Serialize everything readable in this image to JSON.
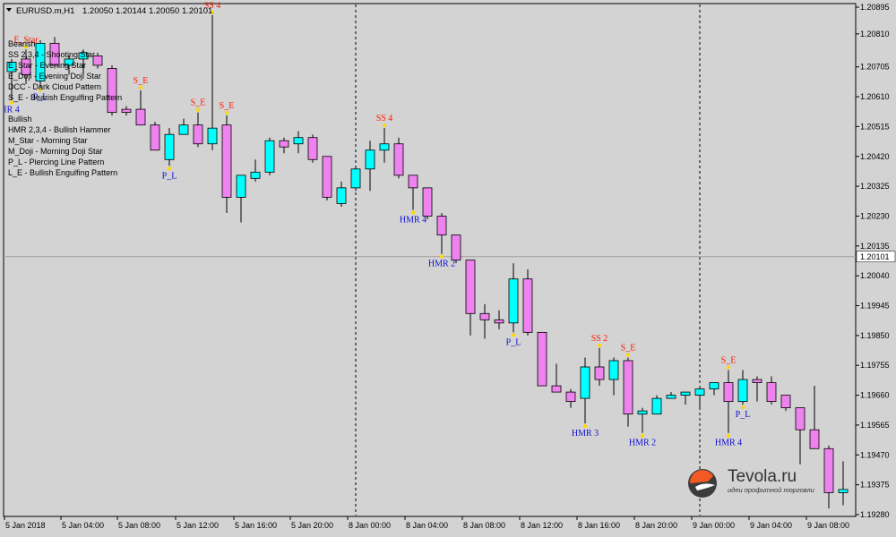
{
  "window": {
    "symbol_info": "EURUSD.m,H1",
    "ohlc_info": "1.20050 1.20144 1.20050 1.20101",
    "menu_glyph": "triangle-down-icon"
  },
  "legend": {
    "lines": [
      {
        "text": "Bearish"
      },
      {
        "text": "SS 2,3,4 - Shooting Star"
      },
      {
        "text": "E_Star   - Evening Star"
      },
      {
        "text": "E_Doji   - Evening Doji Star"
      },
      {
        "text": "DCC      - Dark Cloud Pattern"
      },
      {
        "text": "S_E      - Bearish Engulfing Pattern"
      },
      {
        "text": ""
      },
      {
        "text": "Bullish"
      },
      {
        "text": "HMR 2,3,4 - Bullish Hammer"
      },
      {
        "text": "M_Star    - Morning Star"
      },
      {
        "text": "M_Doji    - Morning Doji Star"
      },
      {
        "text": "P_L       - Piercing Line Pattern"
      },
      {
        "text": "L_E       - Bullish Engulfing Pattern"
      }
    ]
  },
  "watermark": {
    "name": "Tevola.ru",
    "tagline": "идеи профитной торговли"
  },
  "colors": {
    "bull": "#00ffff",
    "bear": "#ee82ee",
    "background": "#d3d3d3",
    "bid_line": "#a0a0a0",
    "pattern_bear": "#ff1a00",
    "pattern_bull": "#1010d0",
    "marker": "#ffd700"
  },
  "chart_data": {
    "type": "candlestick",
    "timeframe": "H1",
    "y_ticks": [
      "1.20895",
      "1.20810",
      "1.20705",
      "1.20610",
      "1.20515",
      "1.20420",
      "1.20325",
      "1.20230",
      "1.20135",
      "1.20040",
      "1.19945",
      "1.19850",
      "1.19755",
      "1.19660",
      "1.19565",
      "1.19470",
      "1.19375",
      "1.19280"
    ],
    "current_price": "1.20101",
    "x_ticks": [
      "5 Jan 2018",
      "5 Jan 04:00",
      "5 Jan 08:00",
      "5 Jan 12:00",
      "5 Jan 16:00",
      "5 Jan 20:00",
      "8 Jan 00:00",
      "8 Jan 04:00",
      "8 Jan 08:00",
      "8 Jan 12:00",
      "8 Jan 16:00",
      "8 Jan 20:00",
      "9 Jan 00:00",
      "9 Jan 04:00",
      "9 Jan 08:00"
    ],
    "day_separators": [
      "8 Jan 00:00",
      "9 Jan 00:00"
    ],
    "candles": [
      {
        "o": 1.2069,
        "h": 1.2073,
        "l": 1.206,
        "c": 1.2072
      },
      {
        "o": 1.2073,
        "h": 1.2076,
        "l": 1.2065,
        "c": 1.2068
      },
      {
        "o": 1.2066,
        "h": 1.2079,
        "l": 1.2064,
        "c": 1.2078
      },
      {
        "o": 1.2078,
        "h": 1.208,
        "l": 1.207,
        "c": 1.2071
      },
      {
        "o": 1.2071,
        "h": 1.2074,
        "l": 1.2068,
        "c": 1.2073
      },
      {
        "o": 1.2073,
        "h": 1.2076,
        "l": 1.2068,
        "c": 1.2075
      },
      {
        "o": 1.2074,
        "h": 1.2075,
        "l": 1.207,
        "c": 1.2071
      },
      {
        "o": 1.207,
        "h": 1.2071,
        "l": 1.2055,
        "c": 1.2056
      },
      {
        "o": 1.2057,
        "h": 1.2058,
        "l": 1.2055,
        "c": 1.2056
      },
      {
        "o": 1.2057,
        "h": 1.2063,
        "l": 1.2052,
        "c": 1.2052
      },
      {
        "o": 1.2052,
        "h": 1.2053,
        "l": 1.2044,
        "c": 1.2044
      },
      {
        "o": 1.2041,
        "h": 1.2051,
        "l": 1.2039,
        "c": 1.2049
      },
      {
        "o": 1.2049,
        "h": 1.2054,
        "l": 1.2049,
        "c": 1.2052
      },
      {
        "o": 1.2052,
        "h": 1.2056,
        "l": 1.2045,
        "c": 1.2046
      },
      {
        "o": 1.2046,
        "h": 1.2087,
        "l": 1.2044,
        "c": 1.2051
      },
      {
        "o": 1.2052,
        "h": 1.2055,
        "l": 1.2024,
        "c": 1.2029
      },
      {
        "o": 1.2029,
        "h": 1.2035,
        "l": 1.2021,
        "c": 1.2036
      },
      {
        "o": 1.2035,
        "h": 1.2041,
        "l": 1.2034,
        "c": 1.2037
      },
      {
        "o": 1.2037,
        "h": 1.2048,
        "l": 1.2036,
        "c": 1.2047
      },
      {
        "o": 1.2047,
        "h": 1.2048,
        "l": 1.2043,
        "c": 1.2045
      },
      {
        "o": 1.2046,
        "h": 1.205,
        "l": 1.2043,
        "c": 1.2048
      },
      {
        "o": 1.2048,
        "h": 1.2049,
        "l": 1.204,
        "c": 1.2041
      },
      {
        "o": 1.2042,
        "h": 1.2042,
        "l": 1.2028,
        "c": 1.2029
      },
      {
        "o": 1.2027,
        "h": 1.2034,
        "l": 1.2026,
        "c": 1.2032
      },
      {
        "o": 1.2032,
        "h": 1.2039,
        "l": 1.2031,
        "c": 1.2038
      },
      {
        "o": 1.2038,
        "h": 1.2047,
        "l": 1.2031,
        "c": 1.2044
      },
      {
        "o": 1.2044,
        "h": 1.2051,
        "l": 1.204,
        "c": 1.2046
      },
      {
        "o": 1.2046,
        "h": 1.2048,
        "l": 1.2035,
        "c": 1.2036
      },
      {
        "o": 1.2036,
        "h": 1.2036,
        "l": 1.2025,
        "c": 1.2032
      },
      {
        "o": 1.2032,
        "h": 1.2032,
        "l": 1.2022,
        "c": 1.2023
      },
      {
        "o": 1.2023,
        "h": 1.2024,
        "l": 1.2011,
        "c": 1.2017
      },
      {
        "o": 1.2017,
        "h": 1.2017,
        "l": 1.2008,
        "c": 1.2009
      },
      {
        "o": 1.2009,
        "h": 1.2009,
        "l": 1.1985,
        "c": 1.1992
      },
      {
        "o": 1.1992,
        "h": 1.1995,
        "l": 1.1984,
        "c": 1.199
      },
      {
        "o": 1.199,
        "h": 1.1993,
        "l": 1.1987,
        "c": 1.1989
      },
      {
        "o": 1.1989,
        "h": 1.2008,
        "l": 1.1986,
        "c": 1.2003
      },
      {
        "o": 1.2003,
        "h": 1.2006,
        "l": 1.1985,
        "c": 1.1986
      },
      {
        "o": 1.1986,
        "h": 1.1986,
        "l": 1.1969,
        "c": 1.1969
      },
      {
        "o": 1.1969,
        "h": 1.1976,
        "l": 1.1967,
        "c": 1.1967
      },
      {
        "o": 1.1967,
        "h": 1.1968,
        "l": 1.1962,
        "c": 1.1964
      },
      {
        "o": 1.1965,
        "h": 1.1978,
        "l": 1.1957,
        "c": 1.1975
      },
      {
        "o": 1.1975,
        "h": 1.1981,
        "l": 1.1969,
        "c": 1.1971
      },
      {
        "o": 1.1971,
        "h": 1.1978,
        "l": 1.1966,
        "c": 1.1977
      },
      {
        "o": 1.1977,
        "h": 1.1978,
        "l": 1.1956,
        "c": 1.196
      },
      {
        "o": 1.196,
        "h": 1.1962,
        "l": 1.1954,
        "c": 1.1961
      },
      {
        "o": 1.196,
        "h": 1.1966,
        "l": 1.196,
        "c": 1.1965
      },
      {
        "o": 1.1965,
        "h": 1.1967,
        "l": 1.1965,
        "c": 1.1966
      },
      {
        "o": 1.1966,
        "h": 1.1967,
        "l": 1.1963,
        "c": 1.1967
      },
      {
        "o": 1.1966,
        "h": 1.1968,
        "l": 1.1962,
        "c": 1.1968
      },
      {
        "o": 1.1968,
        "h": 1.197,
        "l": 1.1966,
        "c": 1.197
      },
      {
        "o": 1.197,
        "h": 1.1974,
        "l": 1.1954,
        "c": 1.1964
      },
      {
        "o": 1.1964,
        "h": 1.1974,
        "l": 1.1963,
        "c": 1.1971
      },
      {
        "o": 1.1971,
        "h": 1.1972,
        "l": 1.1964,
        "c": 1.197
      },
      {
        "o": 1.197,
        "h": 1.1972,
        "l": 1.1963,
        "c": 1.1964
      },
      {
        "o": 1.1966,
        "h": 1.1966,
        "l": 1.1961,
        "c": 1.1962
      },
      {
        "o": 1.1962,
        "h": 1.1962,
        "l": 1.1944,
        "c": 1.1955
      },
      {
        "o": 1.1955,
        "h": 1.1969,
        "l": 1.1949,
        "c": 1.1949
      },
      {
        "o": 1.1949,
        "h": 1.195,
        "l": 1.193,
        "c": 1.1935
      },
      {
        "o": 1.1935,
        "h": 1.1945,
        "l": 1.1931,
        "c": 1.1936
      }
    ],
    "patterns": [
      {
        "label": "S_E",
        "type": "bear",
        "candle": 9
      },
      {
        "label": "SS 4",
        "type": "bear",
        "candle": 14
      },
      {
        "label": "S_E",
        "type": "bear",
        "candle": 13
      },
      {
        "label": "S_E",
        "type": "bear",
        "candle": 15
      },
      {
        "label": "P_L",
        "type": "bull",
        "candle": 11
      },
      {
        "label": "SS 4",
        "type": "bear",
        "candle": 26
      },
      {
        "label": "HMR 4",
        "type": "bull",
        "candle": 28
      },
      {
        "label": "HMR 2",
        "type": "bull",
        "candle": 30
      },
      {
        "label": "P_L",
        "type": "bull",
        "candle": 35
      },
      {
        "label": "SS 2",
        "type": "bear",
        "candle": 41
      },
      {
        "label": "S_E",
        "type": "bear",
        "candle": 43
      },
      {
        "label": "HMR 3",
        "type": "bull",
        "candle": 40
      },
      {
        "label": "HMR 2",
        "type": "bull",
        "candle": 44
      },
      {
        "label": "S_E",
        "type": "bear",
        "candle": 50
      },
      {
        "label": "P_L",
        "type": "bull",
        "candle": 51
      },
      {
        "label": "HMR 4",
        "type": "bull",
        "candle": 50
      },
      {
        "label": "E_Star",
        "type": "bear",
        "candle": 1
      },
      {
        "label": "P_L",
        "type": "bull",
        "candle": 2
      },
      {
        "label": "IR 4",
        "type": "bull",
        "candle": 0
      }
    ]
  }
}
